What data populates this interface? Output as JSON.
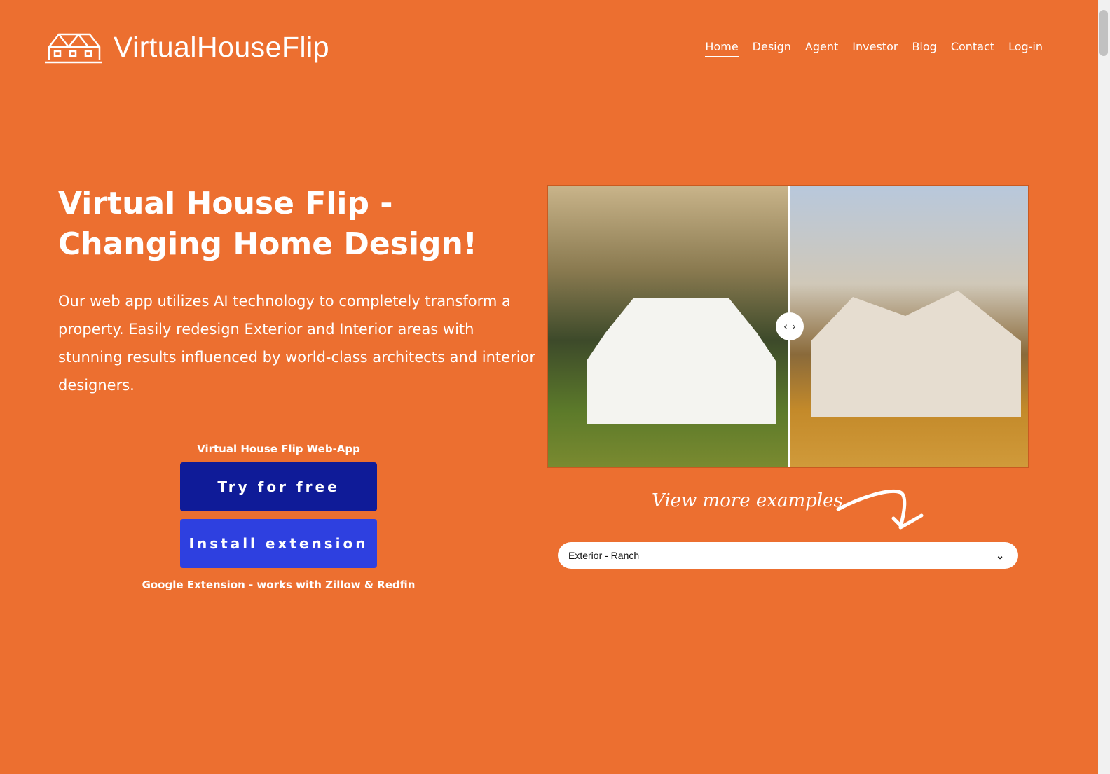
{
  "header": {
    "brand": "VirtualHouseFlip",
    "nav": [
      {
        "label": "Home",
        "active": true
      },
      {
        "label": "Design"
      },
      {
        "label": "Agent"
      },
      {
        "label": "Investor"
      },
      {
        "label": "Blog"
      },
      {
        "label": "Contact"
      },
      {
        "label": "Log-in"
      }
    ]
  },
  "hero": {
    "title": "Virtual House Flip -  Changing Home Design!",
    "description": "Our web app utilizes AI technology to completely transform a property. Easily redesign Exterior and Interior areas with stunning results influenced by world-class architects and interior designers."
  },
  "cta": {
    "label": "Virtual House Flip Web-App",
    "try_button": "Try for free",
    "install_button": "Install extension",
    "note": "Google Extension - works with Zillow & Redfin"
  },
  "examples": {
    "heading": "View more examples",
    "selected": "Exterior - Ranch"
  },
  "colors": {
    "background": "#ec6f30",
    "primary_button": "#0f1b98",
    "secondary_button": "#2e40e0"
  }
}
